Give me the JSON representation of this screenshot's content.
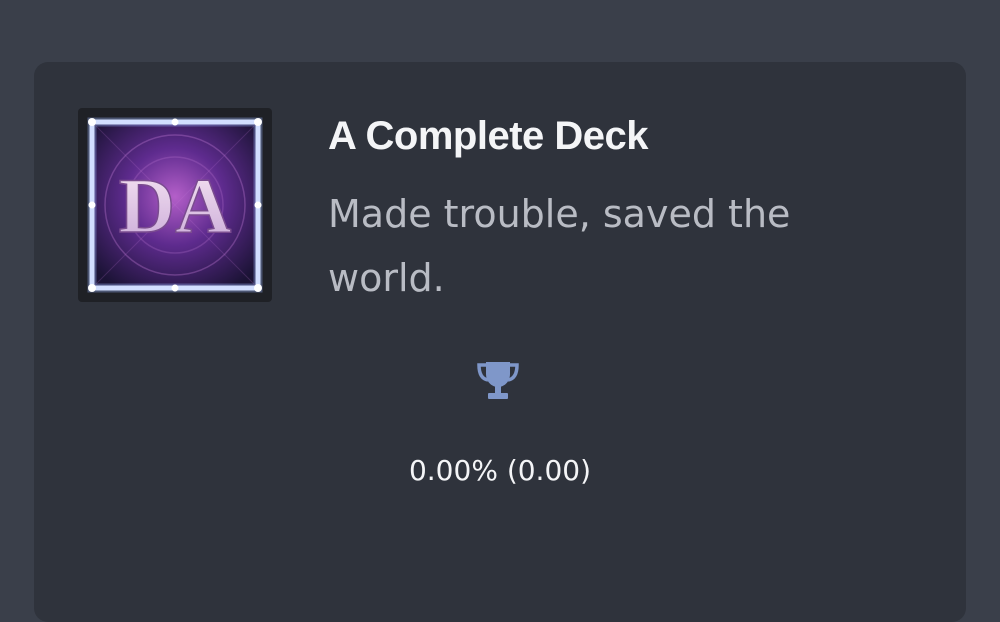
{
  "achievement": {
    "title": "A Complete Deck",
    "description": "Made trouble, saved the world.",
    "icon": "da-logo-icon",
    "icon_text": "DA",
    "stats_text": "0.00% (0.00)"
  },
  "colors": {
    "page_bg": "#3a3f4a",
    "card_bg": "#2f333c",
    "title": "#f4f5f7",
    "description": "#b9bcc4",
    "trophy": "#7f97c9"
  },
  "icons": {
    "trophy": "trophy-icon"
  }
}
